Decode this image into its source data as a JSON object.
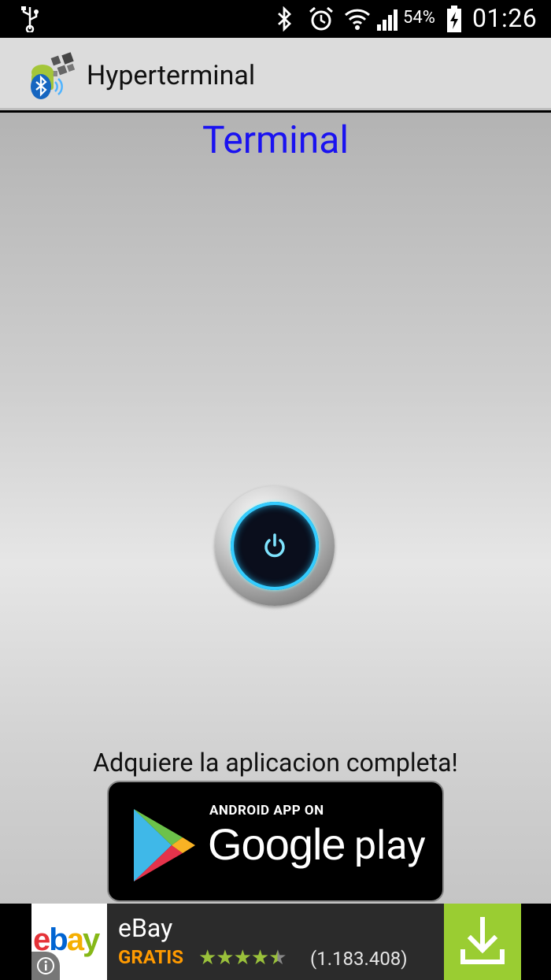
{
  "status_bar": {
    "battery_percent": "54%",
    "time": "01:26",
    "icons": [
      "usb-icon",
      "bluetooth-icon",
      "alarm-icon",
      "wifi-icon",
      "signal-icon",
      "battery-charging-icon"
    ]
  },
  "action_bar": {
    "title": "Hyperterminal",
    "logo_icon": "bluetooth-android-app-icon"
  },
  "main": {
    "title": "Terminal",
    "title_color": "#1a12f0",
    "power_button_icon": "power-icon",
    "promo_text": "Adquiere la aplicacion completa!",
    "gplay_badge": {
      "top_line": "ANDROID APP ON",
      "google_text": "Google",
      "play_text": "play"
    }
  },
  "ad": {
    "logo_letters": [
      "e",
      "b",
      "a",
      "y"
    ],
    "logo_colors": [
      "#e53238",
      "#0064d2",
      "#f5af02",
      "#86b817"
    ],
    "name": "eBay",
    "price": "GRATIS",
    "rating": 4.5,
    "stars": "★★★★★",
    "reviews": "(1.183.408)",
    "info_icon": "info-icon",
    "download_icon": "download-icon",
    "accent_color": "#9acd32"
  }
}
